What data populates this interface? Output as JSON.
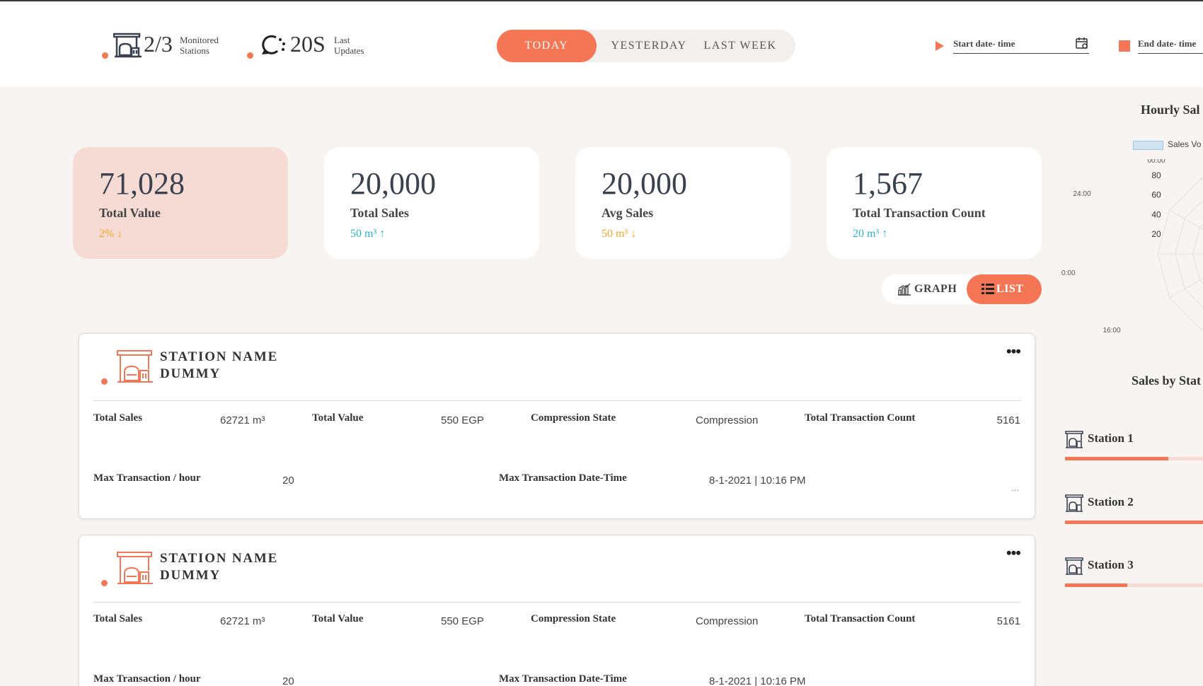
{
  "header": {
    "monitored": {
      "value": "2/3",
      "label_line1": "Monitored",
      "label_line2": "Stations"
    },
    "updates": {
      "value": "20S",
      "label_line1": "Last",
      "label_line2": "Updates"
    },
    "tabs": [
      {
        "label": "TODAY",
        "active": true
      },
      {
        "label": "YESTERDAY",
        "active": false
      },
      {
        "label": "LAST WEEK",
        "active": false
      }
    ],
    "start_date_label": "Start date- time",
    "end_date_label": "End date- time"
  },
  "kpis": [
    {
      "value": "71,028",
      "label": "Total Value",
      "change": "2% ↓",
      "change_color": "orange",
      "highlight": true
    },
    {
      "value": "20,000",
      "label": "Total Sales",
      "change": "50 m³ ↑",
      "change_color": "teal",
      "highlight": false
    },
    {
      "value": "20,000",
      "label": "Avg Sales",
      "change": "50 m³ ↓",
      "change_color": "orange",
      "highlight": false
    },
    {
      "value": "1,567",
      "label": "Total Transaction Count",
      "change": "20 m³ ↑",
      "change_color": "teal",
      "highlight": false
    }
  ],
  "view_toggle": {
    "graph_label": "GRAPH",
    "list_label": "LIST",
    "active": "list"
  },
  "stations": [
    {
      "name": "STATION NAME DUMMY",
      "total_sales_label": "Total Sales",
      "total_sales": "62721 m³",
      "total_value_label": "Total Value",
      "total_value": "550 EGP",
      "compression_label": "Compression State",
      "compression": "Compression",
      "txn_count_label": "Total Transaction Count",
      "txn_count": "5161",
      "max_txn_label": "Max Transaction / hour",
      "max_txn": "20",
      "max_dt_label": "Max Transaction Date-Time",
      "max_dt": "8-1-2021 | 10:16 PM",
      "footer_ellipsis": "..."
    },
    {
      "name": "STATION NAME DUMMY",
      "total_sales_label": "Total Sales",
      "total_sales": "62721 m³",
      "total_value_label": "Total Value",
      "total_value": "550 EGP",
      "compression_label": "Compression State",
      "compression": "Compression",
      "txn_count_label": "Total Transaction Count",
      "txn_count": "5161",
      "max_txn_label": "Max Transaction / hour",
      "max_txn": "20",
      "max_dt_label": "Max Transaction Date-Time",
      "max_dt": "8-1-2021 | 10:16 PM"
    }
  ],
  "right_panel": {
    "hourly_title": "Hourly Sal",
    "legend_label": "Sales Vo",
    "sales_by_station_title": "Sales by Stat",
    "station_bars": [
      {
        "name": "Station 1",
        "fraction": 0.73
      },
      {
        "name": "Station 2",
        "fraction": 1.0
      },
      {
        "name": "Station 3",
        "fraction": 0.44
      }
    ]
  },
  "chart_data": {
    "type": "radar",
    "title": "Hourly Sal",
    "legend": [
      "Sales Vo"
    ],
    "ring_labels": [
      "20",
      "40",
      "60",
      "80"
    ],
    "hour_labels": [
      "00:00",
      "24:00",
      "20:00",
      "16:00"
    ],
    "rmax": 80,
    "series": [
      {
        "name": "Sales Vo",
        "points": [
          {
            "angle_deg": 0,
            "value": 28
          },
          {
            "angle_deg": 30,
            "value": 24
          },
          {
            "angle_deg": 60,
            "value": 22
          },
          {
            "angle_deg": 90,
            "value": 20
          },
          {
            "angle_deg": 120,
            "value": 23
          },
          {
            "angle_deg": 150,
            "value": 26
          }
        ]
      }
    ]
  },
  "colors": {
    "accent": "#f47655",
    "teal": "#2bb5c8",
    "orange_text": "#f5a623",
    "highlight_card": "#f5dbd3",
    "radar_fill": "#cfe3f3",
    "radar_line": "#3d9ad6"
  },
  "icons": {
    "station": "gas-station-icon",
    "refresh": "refresh-icon",
    "calendar": "calendar-icon",
    "graph": "bar-chart-icon",
    "list": "list-icon",
    "more": "more-dots-icon"
  }
}
